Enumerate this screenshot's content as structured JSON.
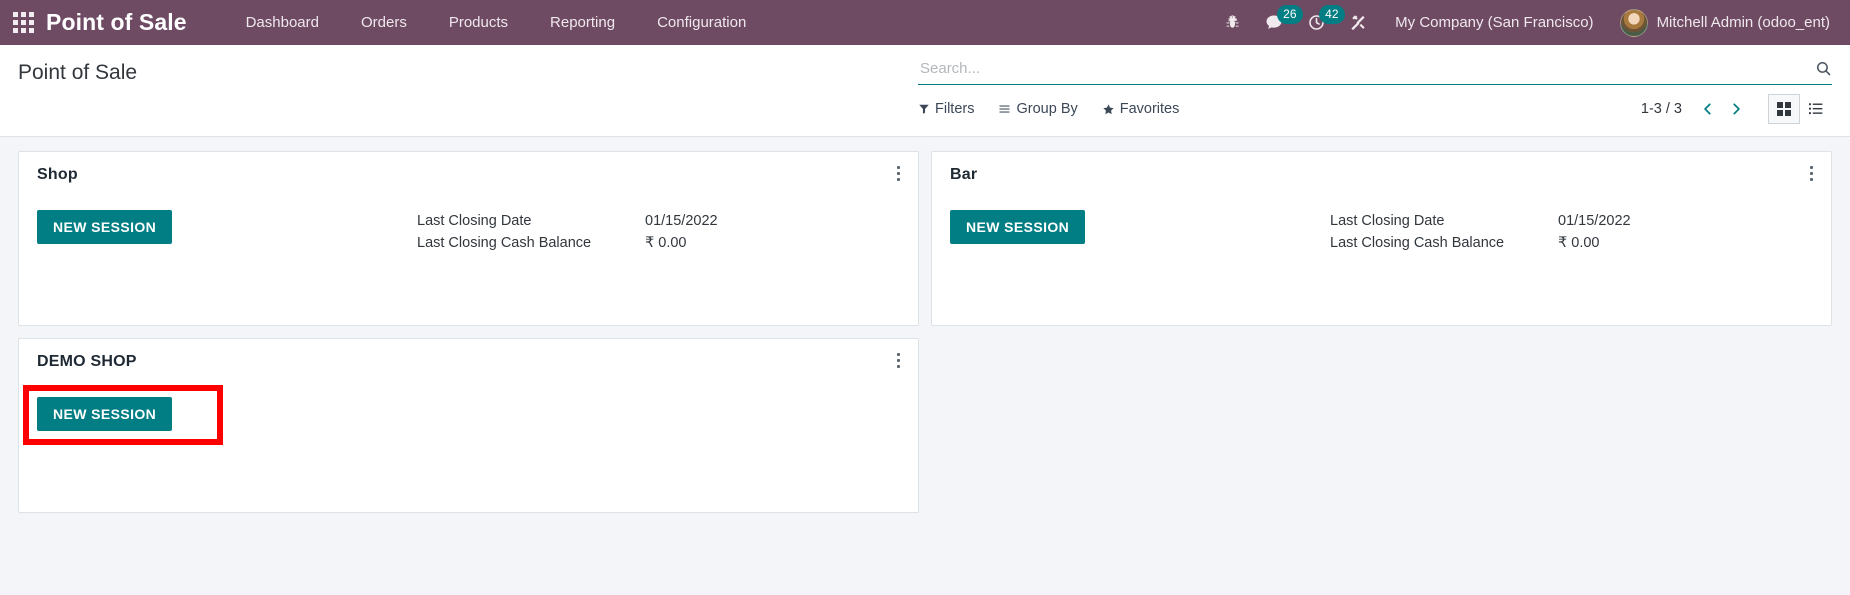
{
  "navbar": {
    "apps_icon": "apps-grid-icon",
    "brand": "Point of Sale",
    "menu": [
      {
        "label": "Dashboard"
      },
      {
        "label": "Orders"
      },
      {
        "label": "Products"
      },
      {
        "label": "Reporting"
      },
      {
        "label": "Configuration"
      }
    ],
    "icons": [
      {
        "name": "bug-icon",
        "badge": null
      },
      {
        "name": "messages-icon",
        "badge": "26"
      },
      {
        "name": "activities-clock-icon",
        "badge": "42"
      },
      {
        "name": "developer-tools-icon",
        "badge": null
      }
    ],
    "company": "My Company (San Francisco)",
    "user": "Mitchell Admin (odoo_ent)",
    "avatar_icon": "user-avatar",
    "background_color": "#6E4A63"
  },
  "control_panel": {
    "page_title": "Point of Sale",
    "search": {
      "placeholder": "Search...",
      "value": "",
      "icon": "search-icon"
    },
    "facets": [
      {
        "label": "Filters",
        "icon": "filter-funnel-icon"
      },
      {
        "label": "Group By",
        "icon": "group-by-lines-icon"
      },
      {
        "label": "Favorites",
        "icon": "favorites-star-icon"
      }
    ],
    "pager": {
      "count": "1-3 / 3",
      "prev_icon": "chevron-left-icon",
      "next_icon": "chevron-right-icon"
    },
    "views": [
      {
        "name": "kanban-view-button",
        "icon": "kanban-grid-icon",
        "active": true
      },
      {
        "name": "list-view-button",
        "icon": "list-icon",
        "active": false
      }
    ]
  },
  "kanban": {
    "new_session_label": "NEW SESSION",
    "menu_icon": "kebab-menu-icon",
    "accent_color": "#017E84",
    "highlight_color": "#FF0000",
    "cards": [
      {
        "title": "Shop",
        "stats": [
          {
            "label": "Last Closing Date",
            "value": "01/15/2022"
          },
          {
            "label": "Last Closing Cash Balance",
            "value": "₹ 0.00"
          }
        ],
        "highlighted": false
      },
      {
        "title": "Bar",
        "stats": [
          {
            "label": "Last Closing Date",
            "value": "01/15/2022"
          },
          {
            "label": "Last Closing Cash Balance",
            "value": "₹ 0.00"
          }
        ],
        "highlighted": false
      },
      {
        "title": "DEMO SHOP",
        "stats": [],
        "highlighted": true
      }
    ]
  }
}
